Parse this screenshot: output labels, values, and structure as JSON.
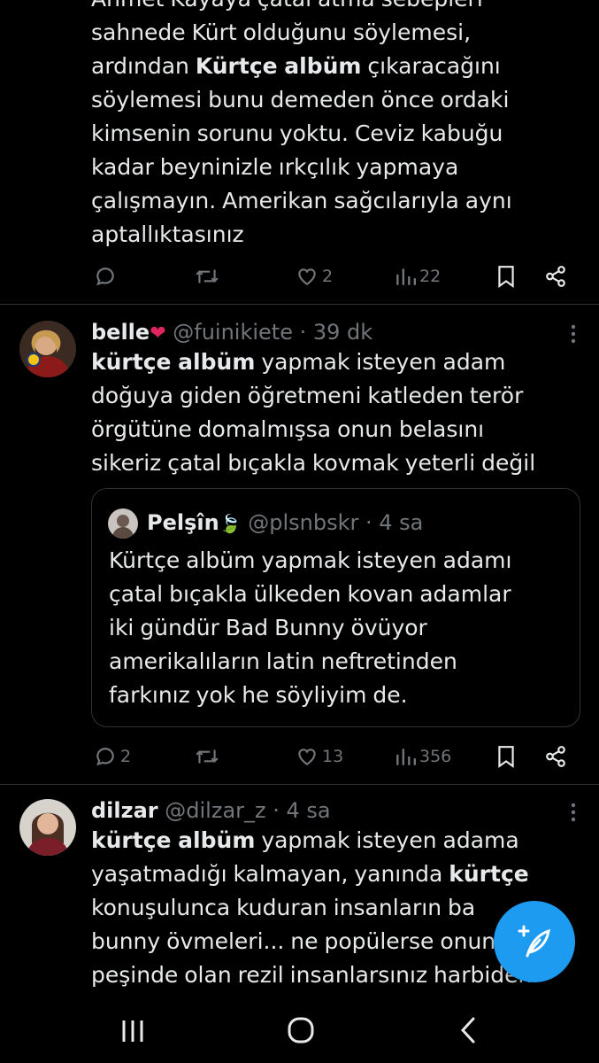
{
  "tweet1": {
    "partial_line": "Ahmet Kayaya çatal atma sebepleri",
    "lines_a": [
      "sahnede Kürt olduğunu söylemesi,"
    ],
    "line_prefix": "ardından ",
    "bold": "Kürtçe albüm",
    "line_suffix": " çıkaracağını",
    "lines_b": [
      "söylemesi bunu demeden önce ordaki",
      "kimsenin sorunu yoktu. Ceviz kabuğu",
      "kadar beyninizle ırkçılık yapmaya",
      "çalışmayın. Amerikan sağcılarıyla aynı",
      "aptallıktasınız"
    ],
    "actions": {
      "replies": "",
      "retweets": "",
      "likes": "2",
      "views": "22"
    }
  },
  "tweet2": {
    "name": "belle",
    "handle": "@fuinikiete",
    "time": "· 39 dk",
    "bold": "kürtçe albüm",
    "first_suffix": " yapmak isteyen adam",
    "lines": [
      "doğuya giden öğretmeni katleden terör",
      "örgütüne domalmışsa onun belasını",
      "sikeriz çatal bıçakla kovmak yeterli değil"
    ],
    "quote": {
      "name": "Pelşîn",
      "handle": "@plsnbskr",
      "time": "· 4 sa",
      "lines": [
        "Kürtçe albüm yapmak isteyen adamı",
        "çatal bıçakla ülkeden kovan adamlar",
        "iki gündür Bad Bunny övüyor",
        "amerikalıların latin neftretinden",
        "farkınız yok he söyliyim de."
      ]
    },
    "actions": {
      "replies": "2",
      "retweets": "",
      "likes": "13",
      "views": "356"
    }
  },
  "tweet3": {
    "name": "dilzar",
    "handle": "@dilzar_z",
    "time": "· 4 sa",
    "bold": "kürtçe albüm",
    "first_suffix": " yapmak isteyen adama",
    "line2": "yaşatmadığı kalmayan, yanında ",
    "line2_bold": "kürtçe",
    "lines": [
      "konuşulunca kuduran insanların ba",
      "bunny övmeleri... ne popülerse onun",
      "peşinde olan rezil insanlarsınız harbiden"
    ]
  },
  "colors": {
    "accent": "#1d9bf0",
    "muted": "#71767b",
    "text": "#e7e9ea",
    "border": "#2f3336"
  },
  "icons": [
    "reply-icon",
    "retweet-icon",
    "like-icon",
    "views-icon",
    "bookmark-icon",
    "share-icon",
    "more-icon",
    "compose-icon",
    "nav-recents-icon",
    "nav-home-icon",
    "nav-back-icon"
  ]
}
